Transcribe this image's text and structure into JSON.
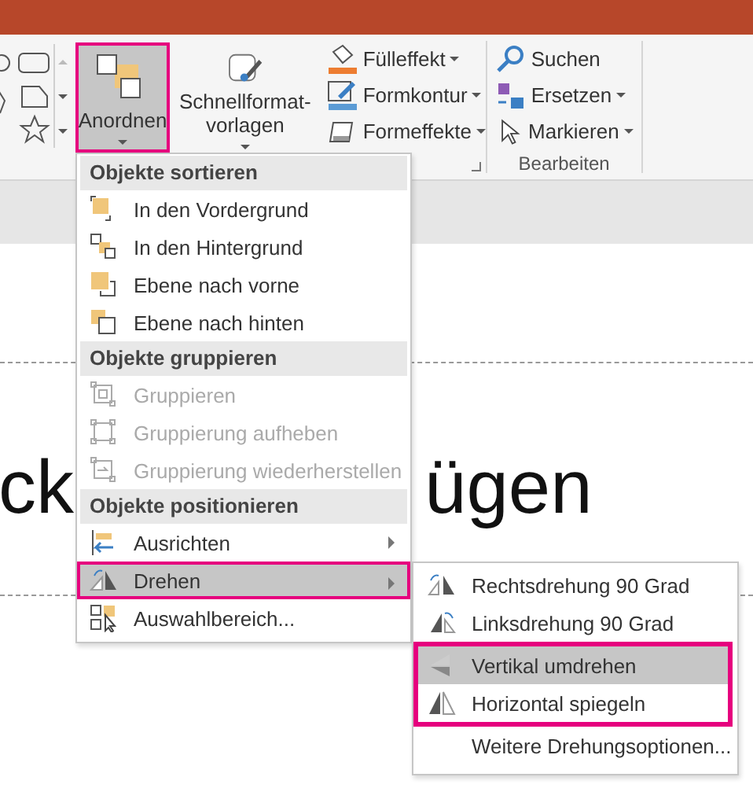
{
  "ribbon": {
    "gallery_scroll": true,
    "big_buttons": [
      {
        "lines": [
          "Anordnen"
        ],
        "dropdown": true,
        "selected": true,
        "framed": true
      },
      {
        "lines": [
          "Schnellformat-",
          "vorlagen"
        ],
        "dropdown": true,
        "selected": false,
        "framed": false
      }
    ],
    "shape_styles": [
      {
        "label": "Fülleffekt",
        "dropdown": true
      },
      {
        "label": "Formkontur",
        "dropdown": true
      },
      {
        "label": "Formeffekte",
        "dropdown": true
      }
    ],
    "editing": {
      "label": "Bearbeiten",
      "items": [
        {
          "label": "Suchen",
          "dropdown": false
        },
        {
          "label": "Ersetzen",
          "dropdown": true
        },
        {
          "label": "Markieren",
          "dropdown": true
        }
      ]
    }
  },
  "slide": {
    "title_parts": [
      "ck",
      "ügen"
    ]
  },
  "menu": {
    "sections": [
      {
        "heading": "Objekte sortieren",
        "items": [
          {
            "label": "In den Vordergrund",
            "disabled": false,
            "submenu": false,
            "selected": false,
            "framed": false
          },
          {
            "label": "In den Hintergrund",
            "disabled": false,
            "submenu": false,
            "selected": false,
            "framed": false
          },
          {
            "label": "Ebene nach vorne",
            "disabled": false,
            "submenu": false,
            "selected": false,
            "framed": false
          },
          {
            "label": "Ebene nach hinten",
            "disabled": false,
            "submenu": false,
            "selected": false,
            "framed": false
          }
        ]
      },
      {
        "heading": "Objekte gruppieren",
        "items": [
          {
            "label": "Gruppieren",
            "disabled": true,
            "submenu": false,
            "selected": false,
            "framed": false
          },
          {
            "label": "Gruppierung aufheben",
            "disabled": true,
            "submenu": false,
            "selected": false,
            "framed": false
          },
          {
            "label": "Gruppierung wiederherstellen",
            "disabled": true,
            "submenu": false,
            "selected": false,
            "framed": false
          }
        ]
      },
      {
        "heading": "Objekte positionieren",
        "items": [
          {
            "label": "Ausrichten",
            "disabled": false,
            "submenu": true,
            "selected": false,
            "framed": false
          },
          {
            "label": "Drehen",
            "disabled": false,
            "submenu": true,
            "selected": true,
            "framed": true
          },
          {
            "label": "Auswahlbereich...",
            "disabled": false,
            "submenu": false,
            "selected": false,
            "framed": false
          }
        ]
      }
    ]
  },
  "submenu": {
    "items": [
      {
        "label": "Rechtsdrehung 90 Grad",
        "selected": false,
        "framed": false
      },
      {
        "label": "Linksdrehung 90 Grad",
        "selected": false,
        "framed": false
      },
      {
        "label": "Vertikal umdrehen",
        "selected": true,
        "framed": true
      },
      {
        "label": "Horizontal spiegeln",
        "selected": false,
        "framed": true
      },
      {
        "label": "Weitere Drehungsoptionen...",
        "selected": false,
        "framed": false
      }
    ]
  }
}
